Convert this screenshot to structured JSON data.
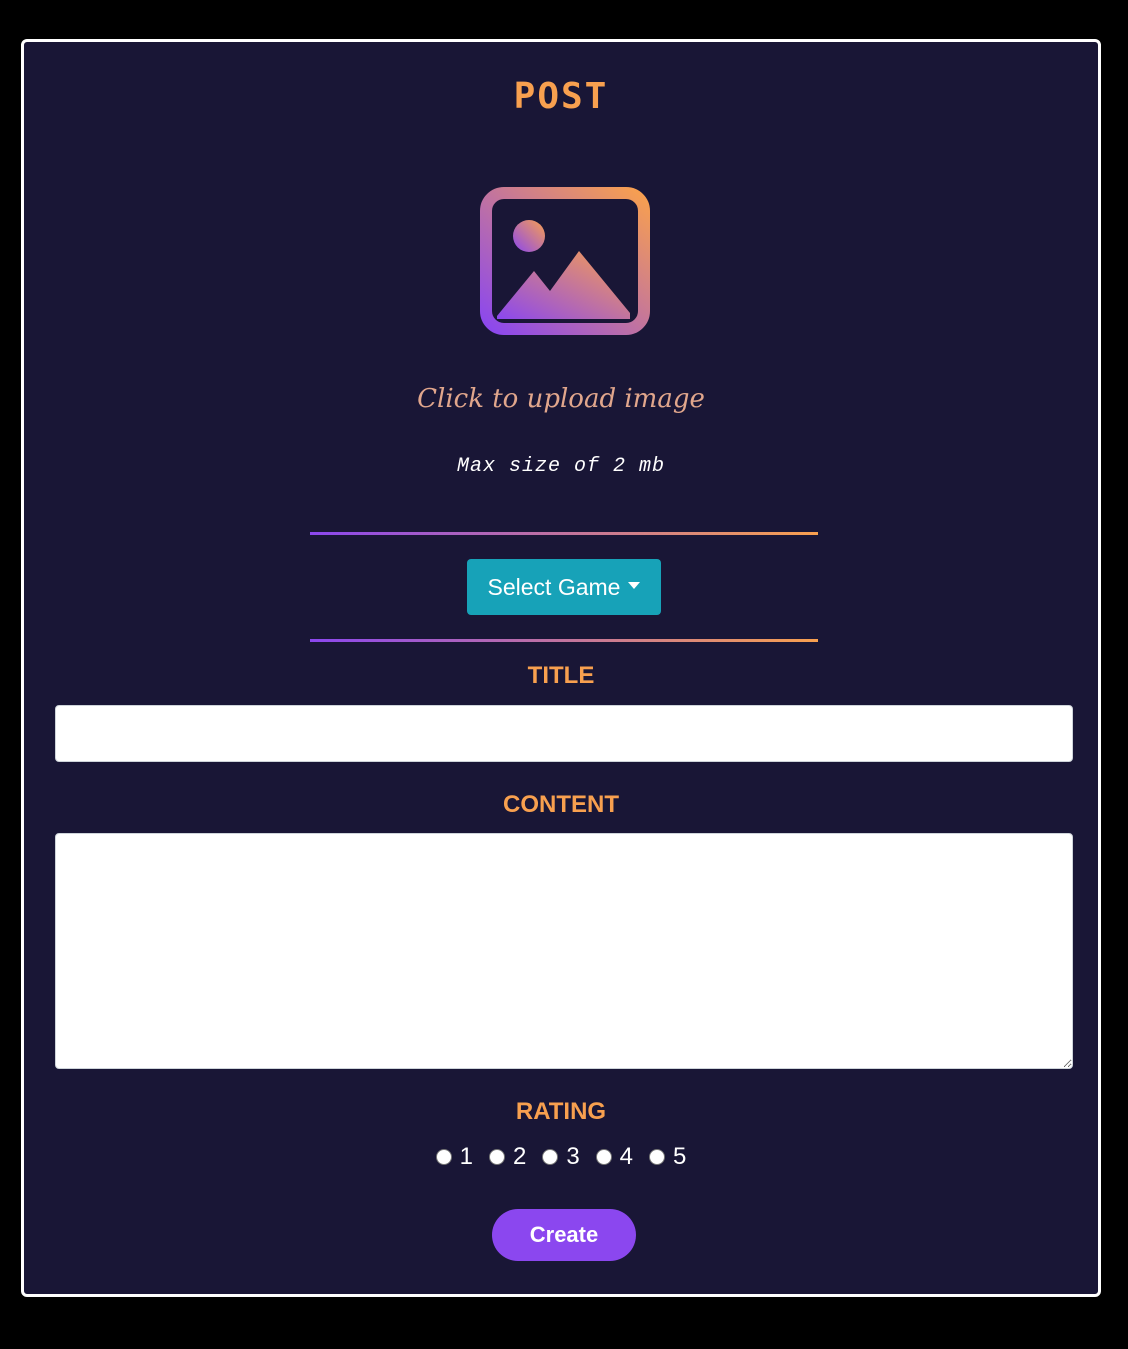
{
  "form": {
    "heading": "POST",
    "upload": {
      "icon": "image-icon",
      "prompt": "Click to upload image",
      "hint": "Max size of 2 mb"
    },
    "game_select": {
      "label": "Select Game",
      "icon": "caret-down-icon"
    },
    "title_field": {
      "label": "TITLE",
      "value": "",
      "placeholder": ""
    },
    "content_field": {
      "label": "CONTENT",
      "value": "",
      "placeholder": ""
    },
    "rating": {
      "label": "RATING",
      "options": [
        "1",
        "2",
        "3",
        "4",
        "5"
      ]
    },
    "submit_label": "Create"
  },
  "colors": {
    "background": "#000000",
    "card": "#191636",
    "accent_orange": "#f8a04f",
    "accent_purple": "#8b47ef",
    "select_button": "#17a2b8"
  }
}
